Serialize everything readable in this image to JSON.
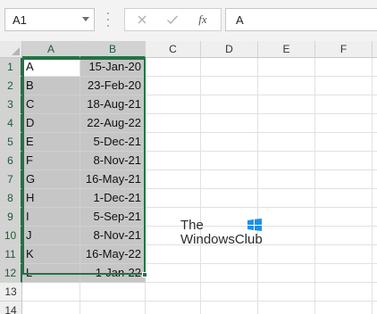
{
  "name_box": {
    "value": "A1"
  },
  "formula_bar": {
    "value": "A",
    "insert_function_label": "fx"
  },
  "columns": [
    "A",
    "B",
    "C",
    "D",
    "E",
    "F"
  ],
  "rows": [
    {
      "num": "1",
      "a": "A",
      "b": "15-Jan-20"
    },
    {
      "num": "2",
      "a": "B",
      "b": "23-Feb-20"
    },
    {
      "num": "3",
      "a": "C",
      "b": "18-Aug-21"
    },
    {
      "num": "4",
      "a": "D",
      "b": "22-Aug-22"
    },
    {
      "num": "5",
      "a": "E",
      "b": "5-Dec-21"
    },
    {
      "num": "6",
      "a": "F",
      "b": "8-Nov-21"
    },
    {
      "num": "7",
      "a": "G",
      "b": "16-May-21"
    },
    {
      "num": "8",
      "a": "H",
      "b": "1-Dec-21"
    },
    {
      "num": "9",
      "a": "I",
      "b": "5-Sep-21"
    },
    {
      "num": "10",
      "a": "J",
      "b": "8-Nov-21"
    },
    {
      "num": "11",
      "a": "K",
      "b": "16-May-22"
    },
    {
      "num": "12",
      "a": "L",
      "b": "1-Jan-22"
    },
    {
      "num": "13",
      "a": "",
      "b": ""
    },
    {
      "num": "14",
      "a": "",
      "b": ""
    }
  ],
  "selection": {
    "range": "A1:B12",
    "active_cell": "A1"
  },
  "watermark": {
    "line1": "The",
    "line2": "WindowsClub"
  },
  "colors": {
    "selection_border": "#217346",
    "selection_fill": "#c6c6c6",
    "header_selected": "#d2d2d2",
    "logo_blue": "#1e90e8"
  }
}
